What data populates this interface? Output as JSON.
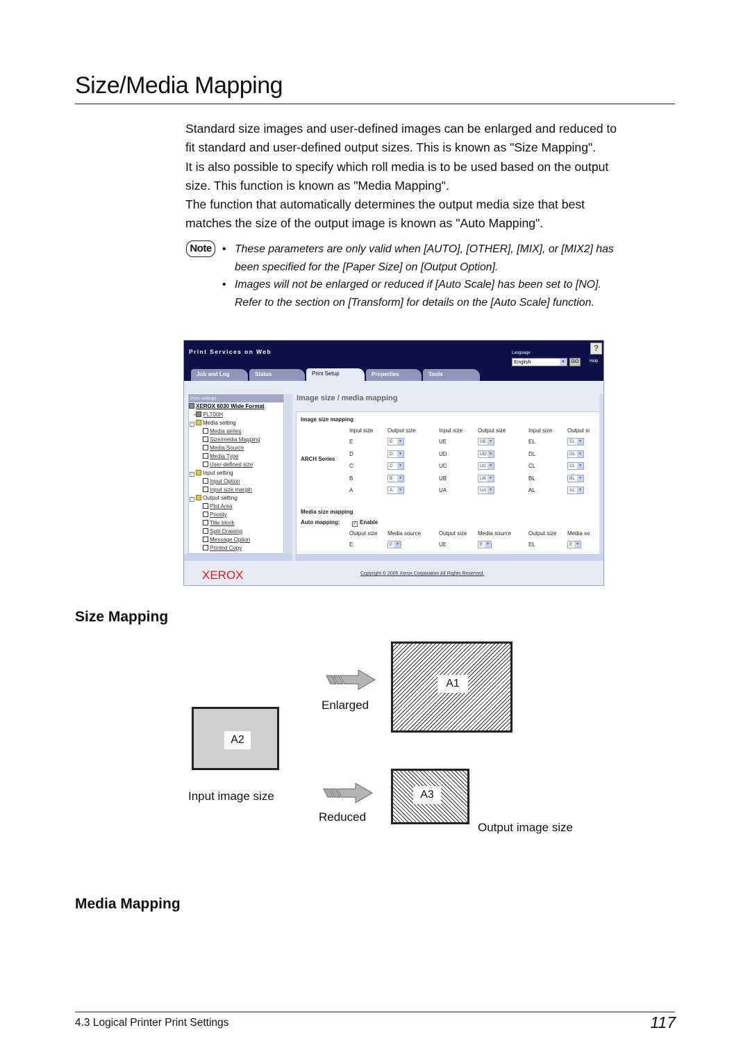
{
  "page": {
    "title": "Size/Media Mapping",
    "intro": [
      "Standard size images and user-defined images can be enlarged and reduced to",
      "fit standard and user-defined output sizes. This is known as \"Size Mapping\".",
      "It is also possible to specify which roll media is to be used based on the output",
      "size. This function is known as \"Media Mapping\".",
      "The function that automatically determines the output media size that best",
      "matches the size of the output image is known as \"Auto Mapping\"."
    ],
    "note": {
      "badge": "Note",
      "bullet": "•",
      "items": [
        [
          "These parameters are only valid when [AUTO], [OTHER], [MIX], or [MIX2] has",
          "been specified for the [Paper Size] on [Output Option]."
        ],
        [
          "Images will not be enlarged or reduced if [Auto Scale] has been set to [NO].",
          "Refer to the section on [Transform] for details on the [Auto Scale] function."
        ]
      ]
    },
    "size_mapping_heading": "Size Mapping",
    "media_mapping_heading": "Media Mapping",
    "footer": {
      "section": "4.3  Logical Printer Print Settings",
      "page_number": "117"
    }
  },
  "app": {
    "title": "Print Services on Web",
    "language_label": "Language",
    "language_value": "English",
    "go_label": "GO",
    "help_label": "Help",
    "help_glyph": "?",
    "tabs": [
      {
        "label": "Job and Log",
        "active": false
      },
      {
        "label": "Status",
        "active": false
      },
      {
        "label": "Print Setup",
        "active": true
      },
      {
        "label": "Properties",
        "active": false
      },
      {
        "label": "Tools",
        "active": false
      }
    ],
    "nav": {
      "header": "Print settings",
      "root": "XEROX 6030 Wide Format",
      "printer": "PLT00H",
      "groups": [
        {
          "label": "Media setting",
          "items": [
            "Media series",
            "Size/media Mapping",
            "Media Source",
            "Media Type",
            "User-defined size"
          ]
        },
        {
          "label": "Input setting",
          "items": [
            "Input Option",
            "Input size margin"
          ]
        },
        {
          "label": "Output setting",
          "items": [
            "Plot Area",
            "Priority",
            "Title block",
            "Split Drawing",
            "Message Option",
            "Printed Copy"
          ]
        }
      ]
    },
    "main": {
      "title": "Image size / media mapping",
      "image_size_mapping": {
        "heading": "Image size mapping",
        "series_label": "ARCH Series",
        "col_headers": [
          "Input size",
          "Output size",
          "Input size",
          "Output size",
          "Input size",
          "Output si"
        ],
        "rows": [
          [
            "E",
            "E",
            "UE",
            "UE",
            "EL",
            "EL"
          ],
          [
            "D",
            "D",
            "UD",
            "UD",
            "DL",
            "DL"
          ],
          [
            "C",
            "C",
            "UC",
            "UC",
            "CL",
            "CL"
          ],
          [
            "B",
            "B",
            "UB",
            "UB",
            "BL",
            "BL"
          ],
          [
            "A",
            "A",
            "UA",
            "UA",
            "AL",
            "AL"
          ]
        ]
      },
      "media_size_mapping": {
        "heading": "Media size mapping",
        "auto_mapping_label": "Auto mapping:",
        "enable_label": "Enable",
        "enable_checked": true,
        "col_headers": [
          "Output size",
          "Media source",
          "Output size",
          "Media source",
          "Output size",
          "Media so"
        ],
        "rows": [
          [
            "E",
            "E",
            "UE",
            "E",
            "EL",
            "E"
          ]
        ]
      }
    },
    "footer": {
      "logo": "XEROX",
      "copyright": "Copyright © 2005 Xerox Corporation All Rights Reserved."
    }
  },
  "diagram": {
    "input_label": "A2",
    "input_caption": "Input image size",
    "enlarged_label": "Enlarged",
    "reduced_label": "Reduced",
    "enlarged_output": "A1",
    "reduced_output": "A3",
    "output_caption": "Output image size"
  }
}
